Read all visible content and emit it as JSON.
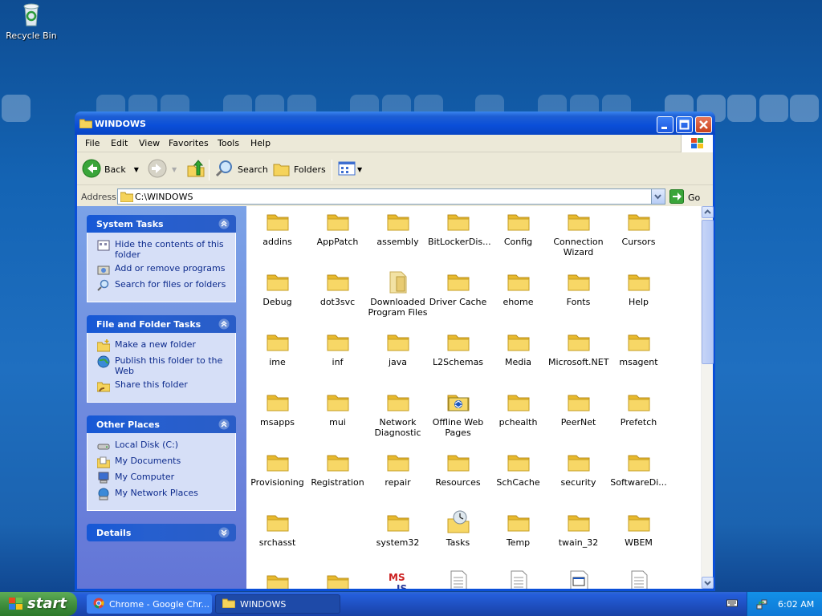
{
  "desktop": {
    "icons": [
      {
        "label": "Recycle Bin",
        "icon": "recycle-bin-icon"
      }
    ]
  },
  "window": {
    "title": "WINDOWS",
    "menu": [
      "File",
      "Edit",
      "View",
      "Favorites",
      "Tools",
      "Help"
    ],
    "toolbar": {
      "back": "Back",
      "search": "Search",
      "folders": "Folders"
    },
    "address": {
      "label": "Address",
      "value": "C:\\WINDOWS",
      "go": "Go"
    },
    "left_pane": {
      "system_tasks": {
        "title": "System Tasks",
        "items": [
          "Hide the contents of this folder",
          "Add or remove programs",
          "Search for files or folders"
        ]
      },
      "file_folder_tasks": {
        "title": "File and Folder Tasks",
        "items": [
          "Make a new folder",
          "Publish this folder to the Web",
          "Share this folder"
        ]
      },
      "other_places": {
        "title": "Other Places",
        "items": [
          "Local Disk (C:)",
          "My Documents",
          "My Computer",
          "My Network Places"
        ]
      },
      "details": {
        "title": "Details"
      }
    },
    "files": [
      {
        "name": "addins",
        "type": "folder"
      },
      {
        "name": "AppPatch",
        "type": "folder"
      },
      {
        "name": "assembly",
        "type": "folder"
      },
      {
        "name": "BitLockerDis...",
        "type": "folder"
      },
      {
        "name": "Config",
        "type": "folder"
      },
      {
        "name": "Connection Wizard",
        "type": "folder"
      },
      {
        "name": "Cursors",
        "type": "folder"
      },
      {
        "name": "Debug",
        "type": "folder"
      },
      {
        "name": "dot3svc",
        "type": "folder"
      },
      {
        "name": "Downloaded Program Files",
        "type": "folder-special"
      },
      {
        "name": "Driver Cache",
        "type": "folder"
      },
      {
        "name": "ehome",
        "type": "folder"
      },
      {
        "name": "Fonts",
        "type": "folder"
      },
      {
        "name": "Help",
        "type": "folder"
      },
      {
        "name": "ime",
        "type": "folder"
      },
      {
        "name": "inf",
        "type": "folder"
      },
      {
        "name": "java",
        "type": "folder"
      },
      {
        "name": "L2Schemas",
        "type": "folder"
      },
      {
        "name": "Media",
        "type": "folder"
      },
      {
        "name": "Microsoft.NET",
        "type": "folder"
      },
      {
        "name": "msagent",
        "type": "folder"
      },
      {
        "name": "msapps",
        "type": "folder"
      },
      {
        "name": "mui",
        "type": "folder"
      },
      {
        "name": "Network Diagnostic",
        "type": "folder"
      },
      {
        "name": "Offline Web Pages",
        "type": "offline"
      },
      {
        "name": "pchealth",
        "type": "folder"
      },
      {
        "name": "PeerNet",
        "type": "folder"
      },
      {
        "name": "Prefetch",
        "type": "folder"
      },
      {
        "name": "Provisioning",
        "type": "folder"
      },
      {
        "name": "Registration",
        "type": "folder"
      },
      {
        "name": "repair",
        "type": "folder"
      },
      {
        "name": "Resources",
        "type": "folder"
      },
      {
        "name": "SchCache",
        "type": "folder"
      },
      {
        "name": "security",
        "type": "folder"
      },
      {
        "name": "SoftwareDi...",
        "type": "folder"
      },
      {
        "name": "srchasst",
        "type": "folder"
      },
      {
        "name": "",
        "type": "empty"
      },
      {
        "name": "system32",
        "type": "folder"
      },
      {
        "name": "Tasks",
        "type": "tasks"
      },
      {
        "name": "Temp",
        "type": "folder"
      },
      {
        "name": "twain_32",
        "type": "folder"
      },
      {
        "name": "WBEM",
        "type": "folder"
      },
      {
        "name": "",
        "type": "folder"
      },
      {
        "name": "",
        "type": "folder"
      },
      {
        "name": "",
        "type": "msjs"
      },
      {
        "name": "",
        "type": "doc"
      },
      {
        "name": "",
        "type": "doc"
      },
      {
        "name": "",
        "type": "window-doc"
      },
      {
        "name": "",
        "type": "doc"
      }
    ]
  },
  "taskbar": {
    "start": "start",
    "tasks": [
      {
        "label": "Chrome - Google Chr...",
        "icon": "chrome-icon"
      },
      {
        "label": "WINDOWS",
        "icon": "folder-icon"
      }
    ],
    "clock": "6:02 AM"
  },
  "colors": {
    "titlebar": "#0a4ed8",
    "taskbar": "#245edb",
    "start": "#3c8a3a",
    "folder": "#f5d35b"
  }
}
